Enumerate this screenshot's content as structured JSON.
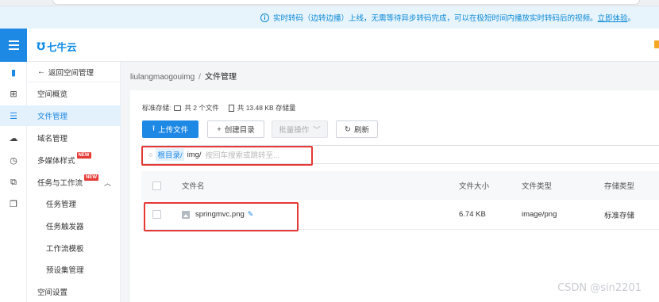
{
  "notice": {
    "text": "实时转码（边转边播）上线，无需等待异步转码完成，可以在极短时间内播放实时转码后的视频。",
    "link": "立即体验",
    "tail": "。"
  },
  "header": {
    "logo_text": "七牛云"
  },
  "iconbar": {
    "icons": [
      "book-icon",
      "grid-icon",
      "database-icon",
      "cloud-icon",
      "clock-icon",
      "workflow-icon",
      "copy-icon"
    ]
  },
  "sidebar": {
    "back": "返回空间管理",
    "overview": "空间概览",
    "file_management": "文件管理",
    "domain_management": "域名管理",
    "media_styles": "多媒体样式",
    "tasks_workflow": "任务与工作流",
    "task_management": "任务管理",
    "task_trigger": "任务触发器",
    "workflow_template": "工作流模板",
    "preset_management": "预设集管理",
    "space_settings": "空间设置",
    "new_badge": "NEW"
  },
  "breadcrumb": {
    "bucket": "liulangmaogouimg",
    "separator": "/",
    "current": "文件管理"
  },
  "storage": {
    "label": "标准存储:",
    "file_count": "共 2 个文件",
    "size": "共 13.48 KB 存储量"
  },
  "toolbar": {
    "upload": "上传文件",
    "create_dir": "创建目录",
    "batch": "批量操作",
    "refresh": "刷新"
  },
  "search": {
    "root": "根目录/",
    "path": "img/",
    "placeholder": "按回车搜索或跳转至..."
  },
  "table": {
    "columns": {
      "name": "文件名",
      "size": "文件大小",
      "type": "文件类型",
      "storage": "存储类型"
    },
    "rows": [
      {
        "name": "springmvc.png",
        "size": "6.74 KB",
        "type": "image/png",
        "storage": "标准存储"
      }
    ]
  },
  "watermark": "CSDN @sin2201",
  "colors": {
    "accent": "#1e88e5",
    "highlight": "#e53935",
    "notice_bg": "#e8f4fc"
  }
}
